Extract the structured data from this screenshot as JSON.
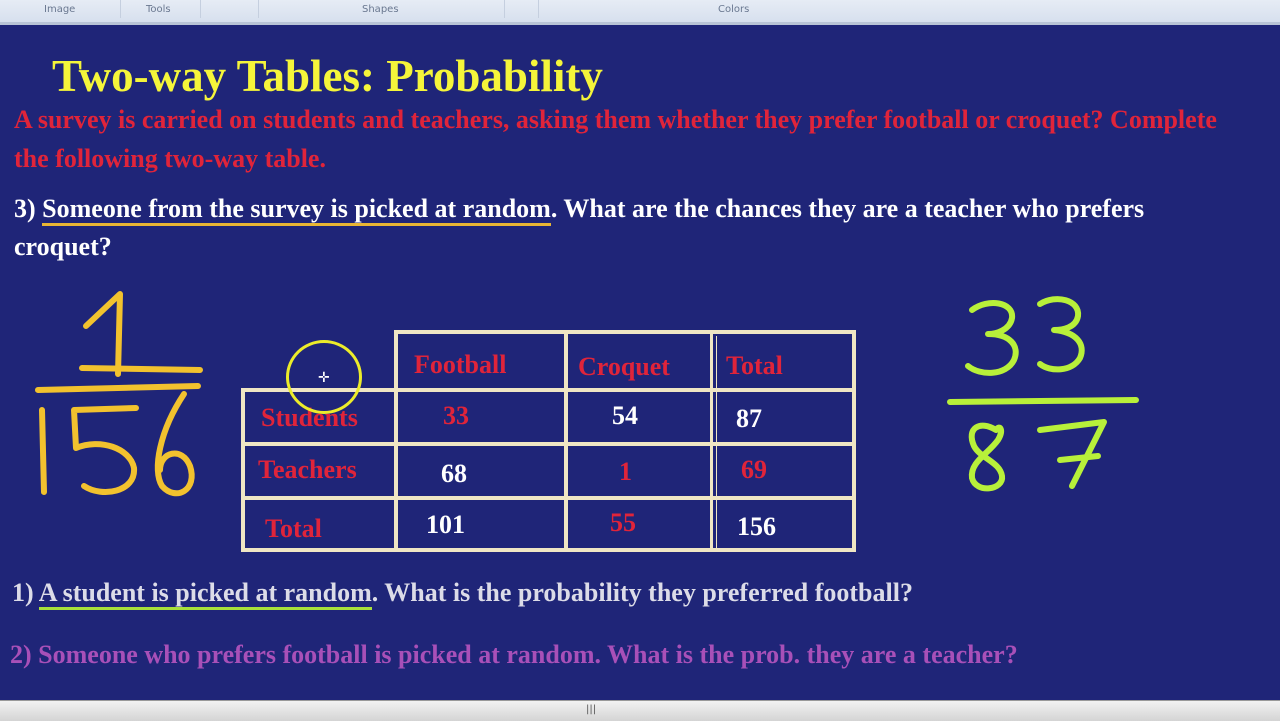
{
  "ribbon": {
    "groups": [
      "Image",
      "Tools",
      "Shapes",
      "Colors"
    ]
  },
  "slide": {
    "title": "Two-way Tables: Probability",
    "intro": "A survey is carried on students and teachers, asking them whether they prefer football or croquet? Complete the following two-way table.",
    "question3": {
      "number": "3)",
      "underlined": "Someone from the survey is picked at random",
      "rest": ". What are the chances they are a teacher who prefers croquet?"
    },
    "question1": {
      "number": "1)",
      "underlined": "A student is picked at random",
      "rest": ". What is the probability they preferred football?"
    },
    "question2": "2) Someone who prefers football is picked at random. What is the prob. they are a teacher?"
  },
  "table": {
    "columns": [
      "Football",
      "Croquet",
      "Total"
    ],
    "rows": [
      {
        "label": "Students",
        "values": [
          "33",
          "54",
          "87"
        ],
        "value_colors": [
          "red",
          "white",
          "white"
        ]
      },
      {
        "label": "Teachers",
        "values": [
          "68",
          "1",
          "69"
        ],
        "value_colors": [
          "white",
          "red",
          "red"
        ]
      },
      {
        "label": "Total",
        "values": [
          "101",
          "55",
          "156"
        ],
        "value_colors": [
          "white",
          "red",
          "white"
        ]
      }
    ]
  },
  "annotations": {
    "left_fraction": {
      "numerator": "1",
      "denominator": "156",
      "color": "#f2c22e"
    },
    "right_fraction": {
      "numerator": "33",
      "denominator": "87",
      "color": "#b8f03a"
    },
    "highlight_circle_color": "#ecec2a"
  },
  "colors": {
    "background": "#1f2578",
    "title": "#f5f53a",
    "intro": "#e0243a",
    "question2": "#a850b8"
  }
}
